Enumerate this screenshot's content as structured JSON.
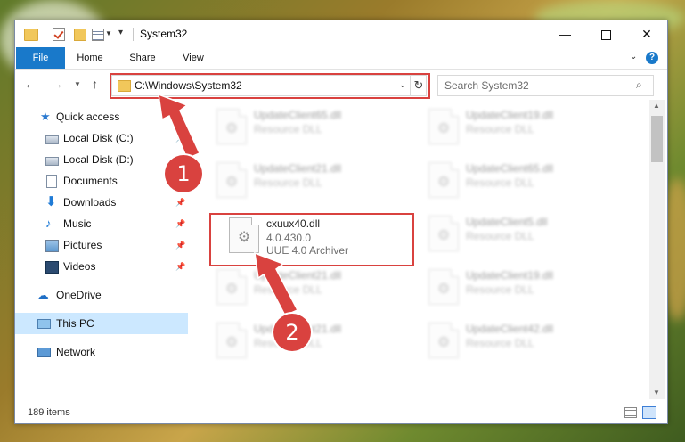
{
  "window": {
    "title": "System32"
  },
  "ribbon": {
    "tabs": [
      {
        "label": "File"
      },
      {
        "label": "Home"
      },
      {
        "label": "Share"
      },
      {
        "label": "View"
      }
    ]
  },
  "address": {
    "path": "C:\\Windows\\System32"
  },
  "search": {
    "placeholder": "Search System32"
  },
  "sidebar": {
    "items": [
      {
        "label": "Quick access"
      },
      {
        "label": "Local Disk (C:)"
      },
      {
        "label": "Local Disk (D:)"
      },
      {
        "label": "Documents"
      },
      {
        "label": "Downloads"
      },
      {
        "label": "Music"
      },
      {
        "label": "Pictures"
      },
      {
        "label": "Videos"
      },
      {
        "label": "OneDrive"
      },
      {
        "label": "This PC"
      },
      {
        "label": "Network"
      }
    ]
  },
  "files": [
    {
      "name": "UpdateClient65.dll",
      "desc": "Resource DLL"
    },
    {
      "name": "UpdateClient19.dll",
      "desc": "Resource DLL"
    },
    {
      "name": "UpdateClient21.dll",
      "desc": "Resource DLL"
    },
    {
      "name": "UpdateClient65.dll",
      "desc": "Resource DLL"
    },
    {
      "name": "cxuux40.dll",
      "desc": "4.0.430.0",
      "desc2": "UUE 4.0 Archiver"
    },
    {
      "name": "UpdateClient5.dll",
      "desc": "Resource DLL"
    },
    {
      "name": "UpdateClient21.dll",
      "desc": "Resource DLL"
    },
    {
      "name": "UpdateClient19.dll",
      "desc": "Resource DLL"
    },
    {
      "name": "UpdateClient21.dll",
      "desc": "Resource DLL"
    },
    {
      "name": "UpdateClient42.dll",
      "desc": "Resource DLL"
    }
  ],
  "status": {
    "count": "189 items"
  },
  "annotations": {
    "badge1": "1",
    "badge2": "2"
  },
  "colors": {
    "highlight": "#d9423f",
    "accent": "#1979ca",
    "selection": "#cce8ff"
  }
}
